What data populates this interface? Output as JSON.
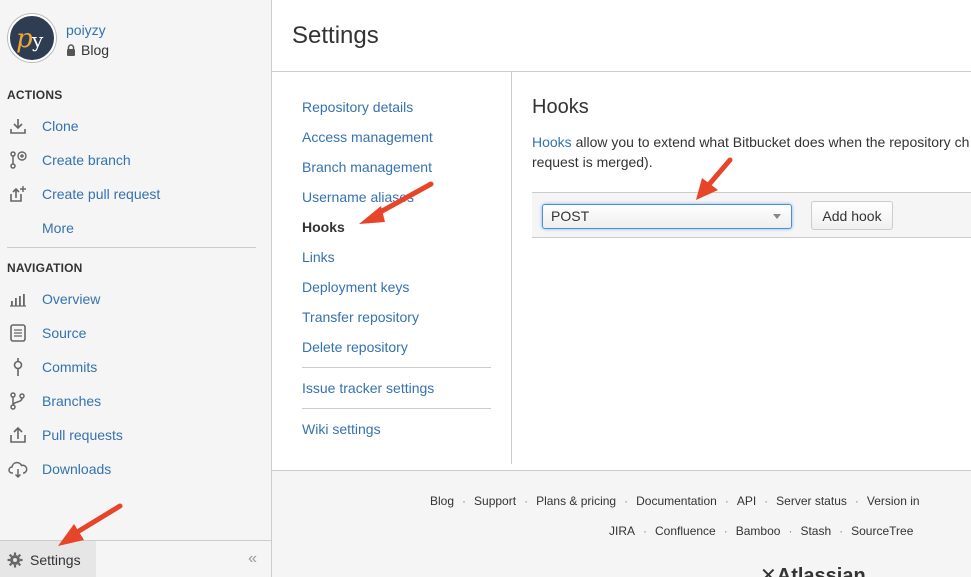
{
  "repo": {
    "owner": "poiyzy",
    "name": "Blog"
  },
  "sidebar": {
    "actions_title": "ACTIONS",
    "actions": [
      {
        "label": "Clone",
        "icon": "download-icon"
      },
      {
        "label": "Create branch",
        "icon": "branch-plus-icon"
      },
      {
        "label": "Create pull request",
        "icon": "pull-request-plus-icon"
      },
      {
        "label": "More",
        "icon": ""
      }
    ],
    "navigation_title": "NAVIGATION",
    "navigation": [
      {
        "label": "Overview",
        "icon": "bar-chart-icon"
      },
      {
        "label": "Source",
        "icon": "document-icon"
      },
      {
        "label": "Commits",
        "icon": "commit-icon"
      },
      {
        "label": "Branches",
        "icon": "branch-icon"
      },
      {
        "label": "Pull requests",
        "icon": "pull-request-icon"
      },
      {
        "label": "Downloads",
        "icon": "cloud-download-icon"
      }
    ],
    "settings_label": "Settings",
    "collapse_label": "«"
  },
  "page": {
    "title": "Settings"
  },
  "settings_nav": {
    "group1": [
      "Repository details",
      "Access management",
      "Branch management",
      "Username aliases",
      "Hooks",
      "Links",
      "Deployment keys",
      "Transfer repository",
      "Delete repository"
    ],
    "group2": [
      "Issue tracker settings"
    ],
    "group3": [
      "Wiki settings"
    ],
    "active": "Hooks"
  },
  "content": {
    "title": "Hooks",
    "desc_link": "Hooks",
    "desc_line1": " allow you to extend what Bitbucket does when the repository ch",
    "desc_line2": "request is merged).",
    "select_value": "POST",
    "add_button": "Add hook"
  },
  "footer": {
    "row1": [
      "Blog",
      "Support",
      "Plans & pricing",
      "Documentation",
      "API",
      "Server status",
      "Version in"
    ],
    "row2": [
      "JIRA",
      "Confluence",
      "Bamboo",
      "Stash",
      "SourceTree"
    ],
    "brand": "Atlassian"
  },
  "colors": {
    "link": "#3572b0",
    "arrow": "#e8442a"
  }
}
